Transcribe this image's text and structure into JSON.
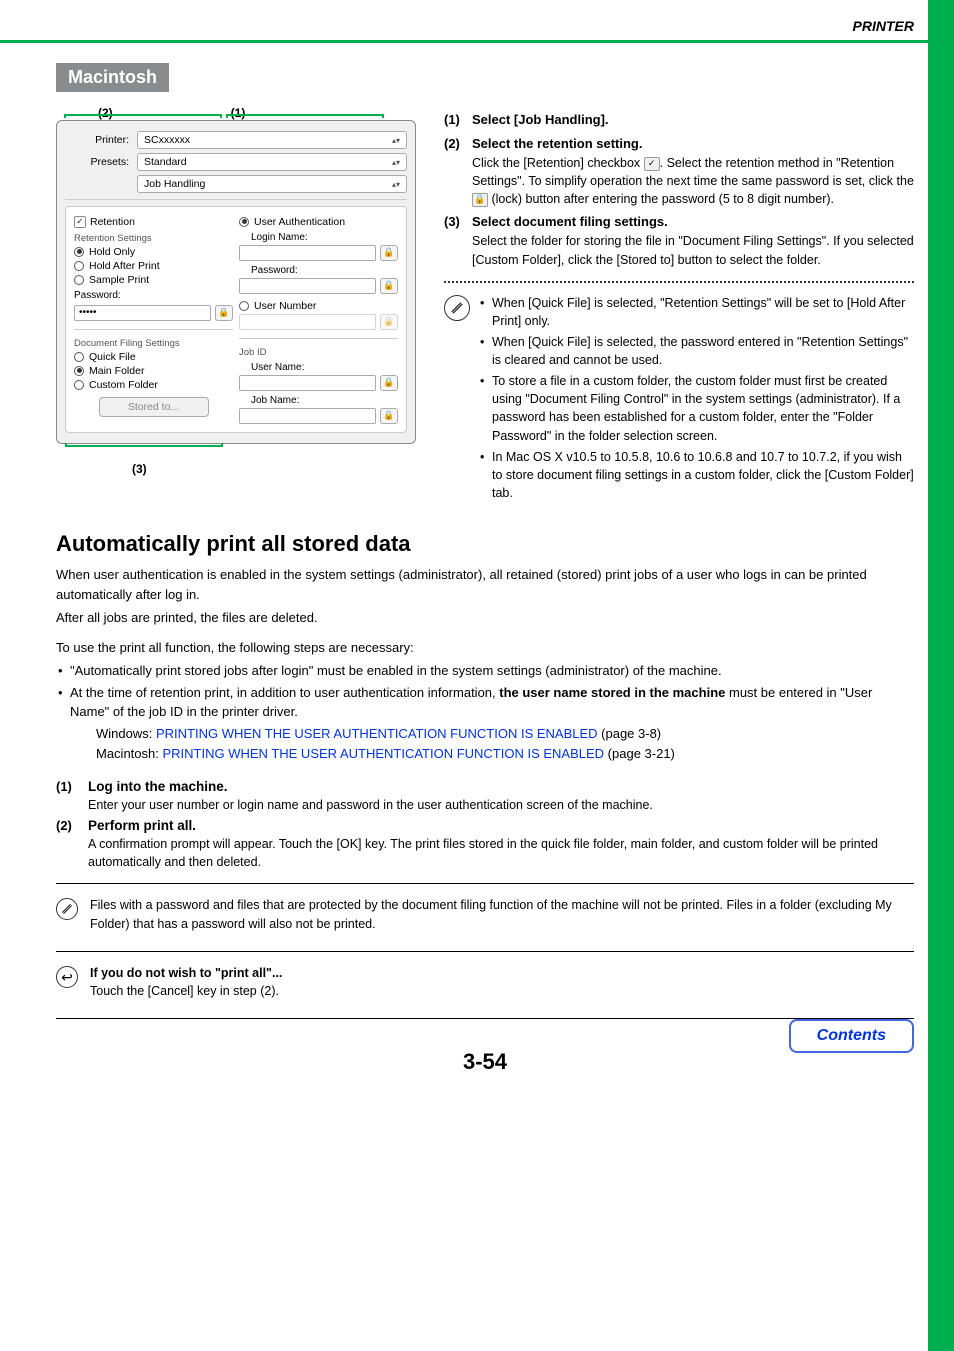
{
  "header": {
    "title": "PRINTER"
  },
  "mac_tag": "Macintosh",
  "callouts": {
    "c1": "(1)",
    "c2": "(2)",
    "c3": "(3)"
  },
  "dialog": {
    "printer_label": "Printer:",
    "printer_value": "SCxxxxxx",
    "presets_label": "Presets:",
    "presets_value": "Standard",
    "panel_value": "Job Handling",
    "retention_chk": "Retention",
    "retention_settings": "Retention Settings",
    "hold_only": "Hold Only",
    "hold_after": "Hold After Print",
    "sample_print": "Sample Print",
    "password_label": "Password:",
    "password_value": "•••••",
    "doc_filing": "Document Filing Settings",
    "quick_file": "Quick File",
    "main_folder": "Main Folder",
    "custom_folder": "Custom Folder",
    "stored_to": "Stored to...",
    "user_auth": "User Authentication",
    "login_name": "Login Name:",
    "password2": "Password:",
    "user_number": "User Number",
    "job_id": "Job ID",
    "user_name": "User Name:",
    "job_name": "Job Name:"
  },
  "steps": {
    "s1_num": "(1)",
    "s1_title": "Select [Job Handling].",
    "s2_num": "(2)",
    "s2_title": "Select the retention setting.",
    "s2_text_a": "Click the [Retention] checkbox ",
    "s2_text_b": ". Select the retention method in \"Retention Settings\". To simplify operation the next time the same password is set, click the ",
    "s2_text_c": " (lock) button after entering the password (5 to 8 digit number).",
    "s3_num": "(3)",
    "s3_title": "Select document filing settings.",
    "s3_text": "Select the folder for storing the file in \"Document Filing Settings\". If you selected [Custom Folder], click the [Stored to] button to select the folder."
  },
  "notes": {
    "n1": "When [Quick File] is selected, \"Retention Settings\" will be set to [Hold After Print] only.",
    "n2": "When [Quick File] is selected, the password entered in \"Retention Settings\" is cleared and cannot be used.",
    "n3": "To store a file in a custom folder, the custom folder must first be created using \"Document Filing Control\" in the system settings (administrator). If a password has been established for a custom folder, enter the \"Folder Password\" in the folder selection screen.",
    "n4": "In Mac OS X v10.5 to 10.5.8, 10.6 to 10.6.8 and 10.7 to 10.7.2, if you wish to store document filing settings in a custom folder, click the [Custom Folder] tab."
  },
  "h2": "Automatically print all stored data",
  "p1": "When user authentication is enabled in the system settings (administrator), all retained (stored) print jobs of a user who logs in can be printed automatically after log in.",
  "p2": "After all jobs are printed, the files are deleted.",
  "p3": "To use the print all function, the following steps are necessary:",
  "li1": "\"Automatically print stored jobs after login\" must be enabled in the system settings (administrator) of the machine.",
  "li2a": "At the time of retention print, in addition to user authentication information, ",
  "li2b": "the user name stored in the machine",
  "li2c": " must be entered in \"User Name\" of the job ID in the printer driver.",
  "win_label": "Windows:",
  "mac_label": "Macintosh:",
  "link_text": "PRINTING WHEN THE USER AUTHENTICATION FUNCTION IS ENABLED",
  "page_ref1": " (page 3-8)",
  "page_ref2": " (page 3-21)",
  "sub1_num": "(1)",
  "sub1_title": "Log into the machine.",
  "sub1_text": "Enter your user number or login name and password in the user authentication screen of the machine.",
  "sub2_num": "(2)",
  "sub2_title": "Perform print all.",
  "sub2_text": "A confirmation prompt will appear. Touch the [OK] key. The print files stored in the quick file folder, main folder, and custom folder will be printed automatically and then deleted.",
  "foot1": "Files with a password and files that are protected by the document filing function of the machine will not be printed. Files in a folder (excluding My Folder) that has a password will also not be printed.",
  "foot2_title": "If you do not wish to \"print all\"...",
  "foot2_text": "Touch the [Cancel] key in step (2).",
  "page_num": "3-54",
  "contents": "Contents"
}
